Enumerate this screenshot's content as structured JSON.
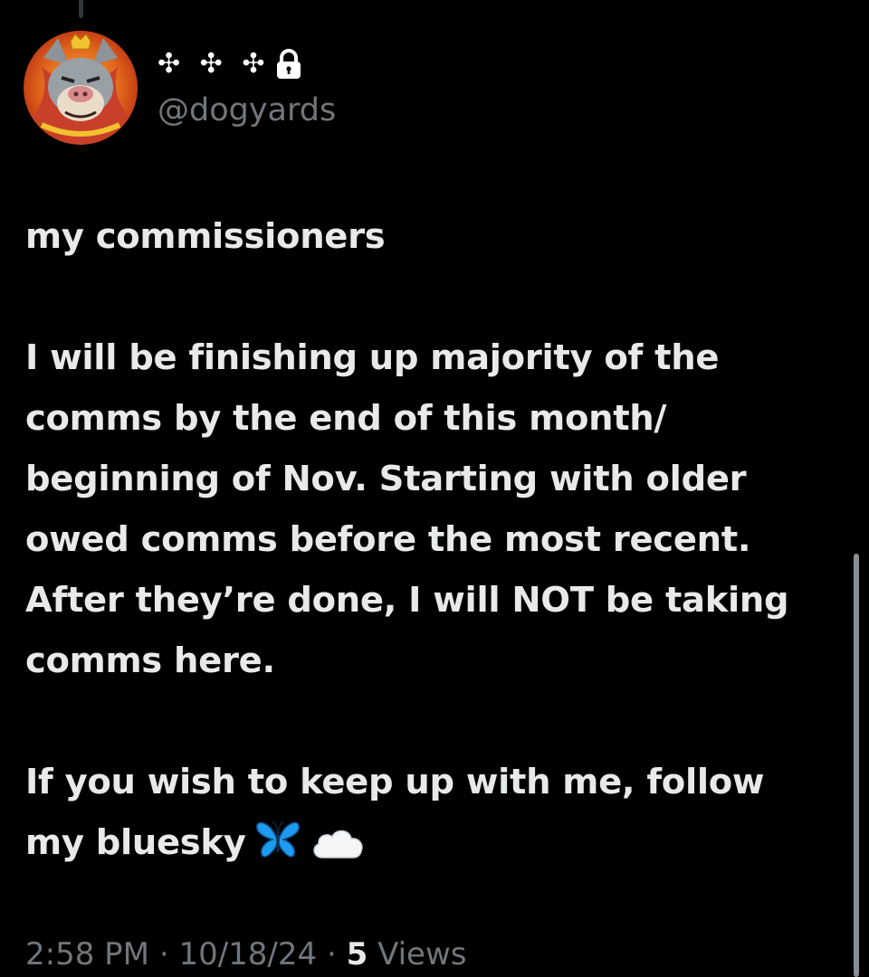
{
  "tweet": {
    "display_name": "✣ ✣ ✣",
    "handle": "@dogyards",
    "lines": [
      "my commissioners",
      "",
      "I will be finishing up majority of the",
      "comms by the end of this month/",
      "beginning of Nov. Starting with older",
      "owed comms before the most recent.",
      "After they’re done, I will NOT be taking",
      "comms here.",
      "",
      "If you wish to keep up with me, follow",
      "my bluesky"
    ],
    "emojis": [
      "butterfly-icon",
      "cloud-icon"
    ],
    "time": "2:58 PM",
    "date": "10/18/24",
    "views_count": "5",
    "views_label": "Views",
    "separator": "·"
  },
  "colors": {
    "background": "#000000",
    "text": "#e7e9ea",
    "muted": "#71767b",
    "butterfly": "#1d9bf0"
  }
}
